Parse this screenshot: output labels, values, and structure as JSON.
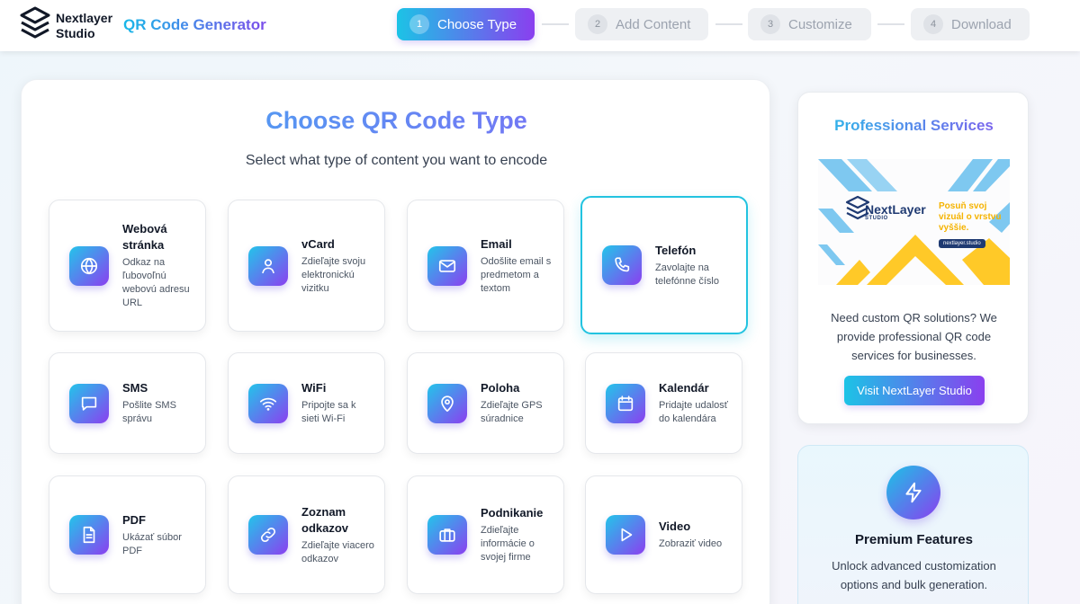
{
  "header": {
    "brand_line1": "Nextlayer",
    "brand_line2": "Studio",
    "app_title": "QR Code Generator",
    "steps": [
      {
        "num": "1",
        "label": "Choose Type"
      },
      {
        "num": "2",
        "label": "Add Content"
      },
      {
        "num": "3",
        "label": "Customize"
      },
      {
        "num": "4",
        "label": "Download"
      }
    ],
    "active_step": 1
  },
  "main": {
    "title": "Choose QR Code Type",
    "subtitle": "Select what type of content you want to encode",
    "selected_type": "Telefón",
    "types": [
      {
        "title": "Webová stránka",
        "desc": "Odkaz na ľubovoľnú webovú adresu URL",
        "icon": "globe-icon"
      },
      {
        "title": "vCard",
        "desc": "Zdieľajte svoju elektronickú vizitku",
        "icon": "user-icon"
      },
      {
        "title": "Email",
        "desc": "Odošlite email s predmetom a textom",
        "icon": "mail-icon"
      },
      {
        "title": "Telefón",
        "desc": "Zavolajte na telefónne číslo",
        "icon": "phone-icon"
      },
      {
        "title": "SMS",
        "desc": "Pošlite SMS správu",
        "icon": "message-icon"
      },
      {
        "title": "WiFi",
        "desc": "Pripojte sa k sieti Wi-Fi",
        "icon": "wifi-icon"
      },
      {
        "title": "Poloha",
        "desc": "Zdieľajte GPS súradnice",
        "icon": "map-pin-icon"
      },
      {
        "title": "Kalendár",
        "desc": "Pridajte udalosť do kalendára",
        "icon": "calendar-icon"
      },
      {
        "title": "PDF",
        "desc": "Ukázať súbor PDF",
        "icon": "file-icon"
      },
      {
        "title": "Zoznam odkazov",
        "desc": "Zdieľajte viacero odkazov",
        "icon": "link-icon"
      },
      {
        "title": "Podnikanie",
        "desc": "Zdieľajte informácie o svojej firme",
        "icon": "briefcase-icon"
      },
      {
        "title": "Video",
        "desc": "Zobraziť video",
        "icon": "play-icon"
      }
    ]
  },
  "sidebar": {
    "services": {
      "title": "Professional Services",
      "banner_brand": "NextLayer",
      "banner_sub": "STUDIO",
      "banner_slogan": "Posuň svoj vizuál o vrstvu vyššie.",
      "banner_url": "nextlayer.studio",
      "desc": "Need custom QR solutions? We provide professional QR code services for businesses.",
      "button": "Visit NextLayer Studio"
    },
    "premium": {
      "title": "Premium Features",
      "desc": "Unlock advanced customization options and bulk generation.",
      "icon": "bolt-icon"
    }
  },
  "colors": {
    "accent_start": "#1cc3e6",
    "accent_end": "#8a3fef",
    "selected_border": "#22c3e0"
  }
}
